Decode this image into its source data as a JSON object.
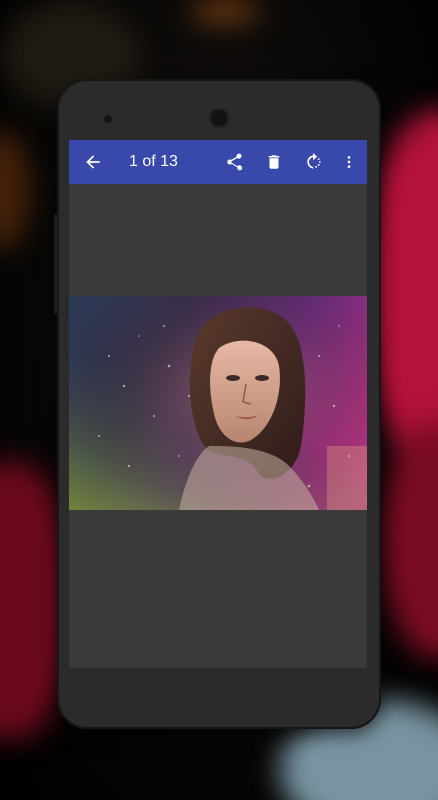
{
  "toolbar": {
    "title": "1 of 13",
    "back_icon": "arrow-back-icon",
    "share_icon": "share-icon",
    "delete_icon": "trash-icon",
    "rotate_icon": "rotate-icon",
    "more_icon": "more-vert-icon"
  },
  "colors": {
    "toolbar": "#3949ab",
    "screen": "#3a3a3a",
    "phone_body": "#2b2b2b"
  },
  "photo": {
    "subject": "portrait-photo"
  }
}
